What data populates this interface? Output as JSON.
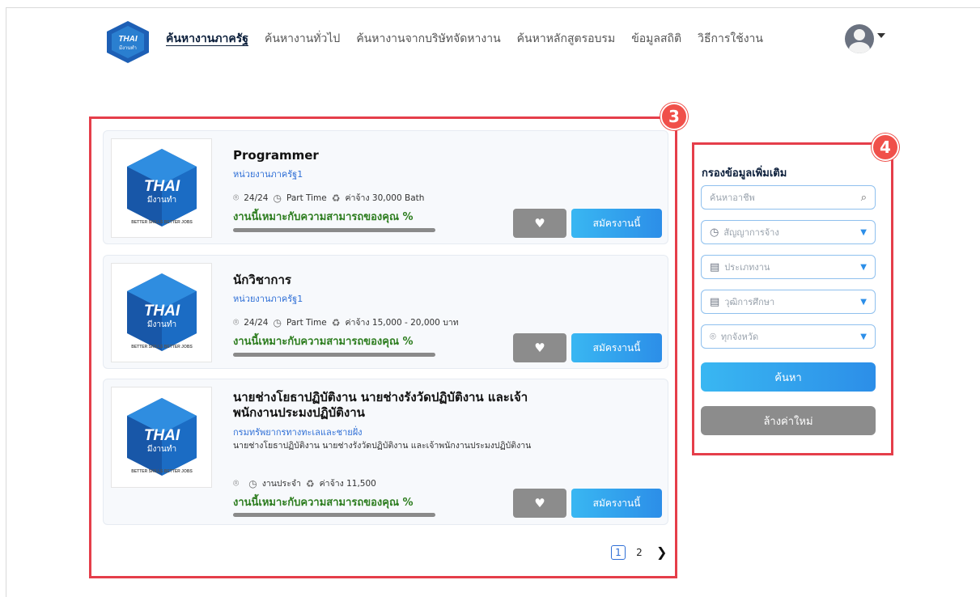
{
  "nav": {
    "items": [
      {
        "label": "ค้นหางานภาครัฐ",
        "active": true
      },
      {
        "label": "ค้นหางานทั่วไป",
        "active": false
      },
      {
        "label": "ค้นหางานจากบริษัทจัดหางาน",
        "active": false
      },
      {
        "label": "ค้นหาหลักสูตรอบรม",
        "active": false
      },
      {
        "label": "ข้อมูลสถิติ",
        "active": false
      },
      {
        "label": "วิธีการใช้งาน",
        "active": false
      }
    ]
  },
  "logo": {
    "top": "THAI",
    "bottom": "มีงานทำ",
    "ring": "BETTER SKILLS BETTER JOBS"
  },
  "badges": {
    "list": "3",
    "filter": "4"
  },
  "jobs": [
    {
      "title": "Programmer",
      "org": "หน่วยงานภาครัฐ1",
      "positions": "24/24",
      "type": "Part Time",
      "salary": "ค่าจ้าง 30,000 Bath",
      "match": "งานนี้เหมาะกับความสามารถของคุณ %",
      "apply": "สมัครงานนี้"
    },
    {
      "title": "นักวิชาการ",
      "org": "หน่วยงานภาครัฐ1",
      "positions": "24/24",
      "type": "Part Time",
      "salary": "ค่าจ้าง 15,000 - 20,000 บาท",
      "match": "งานนี้เหมาะกับความสามารถของคุณ %",
      "apply": "สมัครงานนี้"
    },
    {
      "title": "นายช่างโยธาปฏิบัติงาน นายช่างรังวัดปฏิบัติงาน และเจ้าพนักงานประมงปฏิบัติงาน",
      "org": "กรมทรัพยากรทางทะเลและชายฝั่ง",
      "desc": "นายช่างโยธาปฏิบัติงาน นายช่างรังวัดปฏิบัติงาน และเจ้าพนักงานประมงปฏิบัติงาน",
      "positions": "",
      "type": "งานประจำ",
      "salary": "ค่าจ้าง 11,500",
      "match": "งานนี้เหมาะกับความสามารถของคุณ %",
      "apply": "สมัครงานนี้"
    }
  ],
  "pagination": {
    "pages": [
      "1",
      "2"
    ],
    "current": "1",
    "next_icon": "chevron-right-icon"
  },
  "filter": {
    "title": "กรองข้อมูลเพิ่มเติม",
    "search_placeholder": "ค้นหาอาชีพ",
    "contract": "สัญญาการจ้าง",
    "job_type": "ประเภทงาน",
    "education": "วุฒิการศึกษา",
    "province": "ทุกจังหวัด",
    "search_button": "ค้นหา",
    "reset_button": "ล้างค่าใหม่"
  },
  "colors": {
    "accent": "#2c8ee8",
    "highlight": "#e53e4a",
    "match": "#2d7d1f"
  }
}
